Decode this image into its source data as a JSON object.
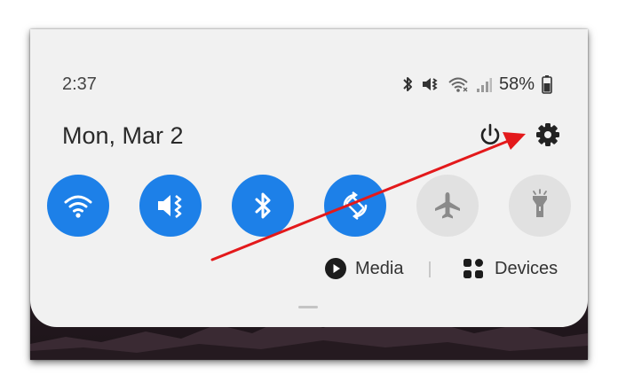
{
  "status_bar": {
    "time": "2:37",
    "battery_text": "58%",
    "icons": [
      "bluetooth-icon",
      "vibrate-icon",
      "wifi-icon",
      "signal-icon",
      "battery-icon"
    ]
  },
  "header": {
    "date": "Mon, Mar 2",
    "power_icon": "power-icon",
    "settings_icon": "gear-icon"
  },
  "quick_toggles": [
    {
      "name": "wifi-toggle",
      "icon": "wifi-icon",
      "state": "on"
    },
    {
      "name": "vibrate-toggle",
      "icon": "vibrate-icon",
      "state": "on"
    },
    {
      "name": "bluetooth-toggle",
      "icon": "bluetooth-icon",
      "state": "on"
    },
    {
      "name": "auto-rotate-toggle",
      "icon": "rotate-icon",
      "state": "on"
    },
    {
      "name": "airplane-toggle",
      "icon": "airplane-icon",
      "state": "off"
    },
    {
      "name": "flashlight-toggle",
      "icon": "flashlight-icon",
      "state": "off"
    }
  ],
  "footer": {
    "media_label": "Media",
    "devices_label": "Devices"
  },
  "colors": {
    "toggle_on": "#1d80e8",
    "toggle_off": "#e1e1e1",
    "panel_bg": "#f1f1f1",
    "annotation_arrow": "#e3191b"
  }
}
